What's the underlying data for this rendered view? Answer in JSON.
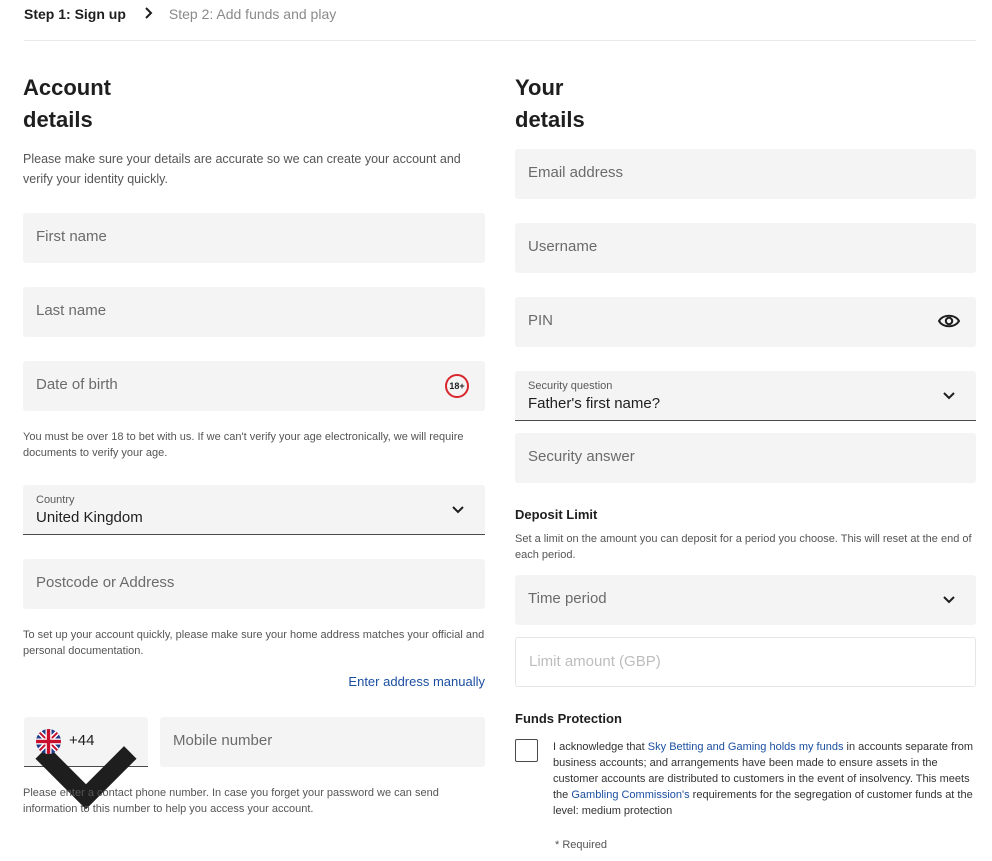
{
  "steps": {
    "step1": "Step 1: Sign up",
    "step2": "Step 2: Add funds and play"
  },
  "account": {
    "title_line1": "Account",
    "title_line2": "details",
    "intro": "Please make sure your details are accurate so we can create your account and verify your identity quickly.",
    "first_name_placeholder": "First name",
    "last_name_placeholder": "Last name",
    "dob_placeholder": "Date of birth",
    "age_badge": "18+",
    "age_note": "You must be over 18 to bet with us. If we can't verify your age electronically, we will require documents to verify your age.",
    "country_label": "Country",
    "country_value": "United Kingdom",
    "postcode_placeholder": "Postcode or Address",
    "address_note": "To set up your account quickly, please make sure your home address matches your official and personal documentation.",
    "enter_manually": "Enter address manually",
    "phone_code": "+44",
    "mobile_placeholder": "Mobile number",
    "phone_note": "Please enter a contact phone number. In case you forget your password we can send information to this number to help you access your account."
  },
  "your": {
    "title_line1": "Your",
    "title_line2": "details",
    "email_placeholder": "Email address",
    "username_placeholder": "Username",
    "pin_placeholder": "PIN",
    "security_label": "Security question",
    "security_value": "Father's first name?",
    "security_answer_placeholder": "Security answer",
    "deposit_heading": "Deposit Limit",
    "deposit_note": "Set a limit on the amount you can deposit for a period you choose. This will reset at the end of each period.",
    "time_period_placeholder": "Time period",
    "limit_amount_placeholder": "Limit amount (GBP)",
    "funds_heading": "Funds Protection",
    "funds_text_1": "I acknowledge that ",
    "funds_link_1": "Sky Betting and Gaming holds my funds",
    "funds_text_2": " in accounts separate from business accounts; and arrangements have been made to ensure assets in the customer accounts are distributed to customers in the event of insolvency. This meets the ",
    "funds_link_2": "Gambling Commission's",
    "funds_text_3": " requirements for the segregation of customer funds at the level: medium protection",
    "required": "* Required"
  },
  "colors": {
    "link": "#1b4fa1",
    "badge_red": "#d8262c",
    "field_bg": "#f4f4f4"
  }
}
